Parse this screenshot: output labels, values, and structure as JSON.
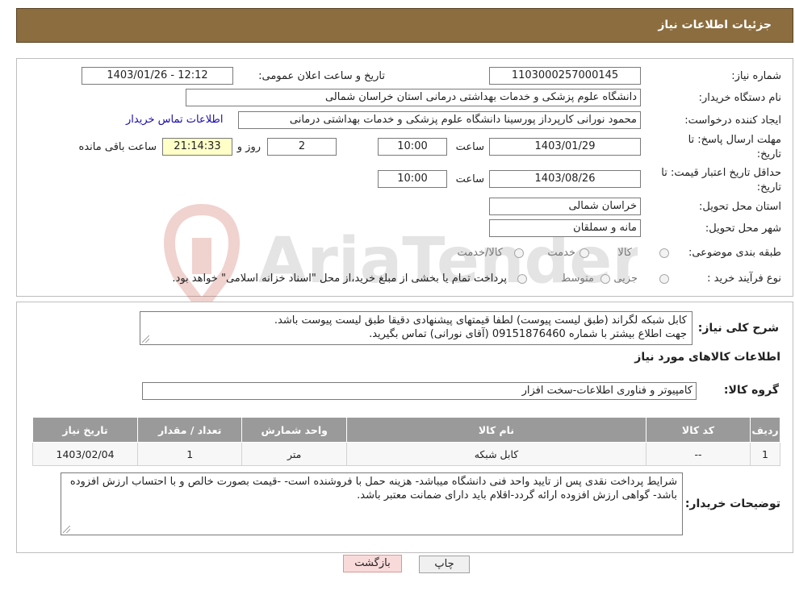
{
  "header": {
    "title": "جزئیات اطلاعات نیاز"
  },
  "form": {
    "need_number_label": "شماره نیاز:",
    "need_number": "1103000257000145",
    "announce_label": "تاریخ و ساعت اعلان عمومی:",
    "announce_value": "1403/01/26 - 12:12",
    "buyer_org_label": "نام دستگاه خریدار:",
    "buyer_org": "دانشگاه علوم پزشکی و خدمات بهداشتی درمانی استان خراسان شمالی",
    "creator_label": "ایجاد کننده درخواست:",
    "creator": "محمود نورانی کارپرداز پورسینا دانشگاه علوم پزشکی و خدمات بهداشتی درمانی",
    "contact_link": "اطلاعات تماس خریدار",
    "deadline_label_1": "مهلت ارسال پاسخ: تا",
    "deadline_label_2": "تاریخ:",
    "deadline_date": "1403/01/29",
    "time_label": "ساعت",
    "deadline_time": "10:00",
    "days_value": "2",
    "days_label": "روز و",
    "remaining_value": "21:14:33",
    "remaining_label": "ساعت باقی مانده",
    "validity_label_1": "حداقل تاریخ اعتبار قیمت: تا",
    "validity_label_2": "تاریخ:",
    "validity_date": "1403/08/26",
    "validity_time": "10:00",
    "province_label": "استان محل تحویل:",
    "province": "خراسان شمالی",
    "city_label": "شهر محل تحویل:",
    "city": "مانه و سملقان",
    "category_label": "طبقه بندی موضوعی:",
    "cat_opt1": "کالا",
    "cat_opt2": "خدمت",
    "cat_opt3": "کالا/خدمت",
    "process_label": "نوع فرآیند خرید :",
    "proc_opt1": "جزیی",
    "proc_opt2": "متوسط",
    "proc_note": "پرداخت تمام یا بخشی از مبلغ خرید،از محل \"اسناد خزانه اسلامی\" خواهد بود."
  },
  "need": {
    "desc_label": "شرح کلی نیاز:",
    "desc_line1": "کابل شبکه لگراند (طبق لیست پیوست) لطفا قیمتهای پیشنهادی دقیقا طبق لیست پیوست باشد.",
    "desc_line2": "جهت اطلاع بیشتر با شماره 09151876460 (آقای نورانی) تماس بگیرید.",
    "goods_title": "اطلاعات کالاهای مورد نیاز",
    "group_label": "گروه کالا:",
    "group_value": "کامپیوتر و فناوری اطلاعات-سخت افزار",
    "table": {
      "headers": [
        "ردیف",
        "کد کالا",
        "نام کالا",
        "واحد شمارش",
        "تعداد / مقدار",
        "تاریخ نیاز"
      ],
      "rows": [
        [
          "1",
          "--",
          "کابل شبکه",
          "متر",
          "1",
          "1403/02/04"
        ]
      ]
    },
    "notes_label": "توضیحات خریدار:",
    "notes_text": "شرایط پرداخت نقدی پس از تایید واحد فنی دانشگاه میباشد- هزینه حمل با فروشنده است- -قیمت بصورت خالص و با احتساب ارزش افزوده  باشد- گواهی ارزش افزوده ارائه گردد-اقلام باید دارای ضمانت معتبر باشد."
  },
  "buttons": {
    "print": "چاپ",
    "back": "بازگشت"
  },
  "watermark": {
    "text": "AriaTender.neT"
  },
  "colors": {
    "header_bg": "#8c6d3f",
    "table_header_bg": "#9a9a9a",
    "back_button_bg": "#f9dada",
    "print_button_bg": "#f0f0f0"
  }
}
